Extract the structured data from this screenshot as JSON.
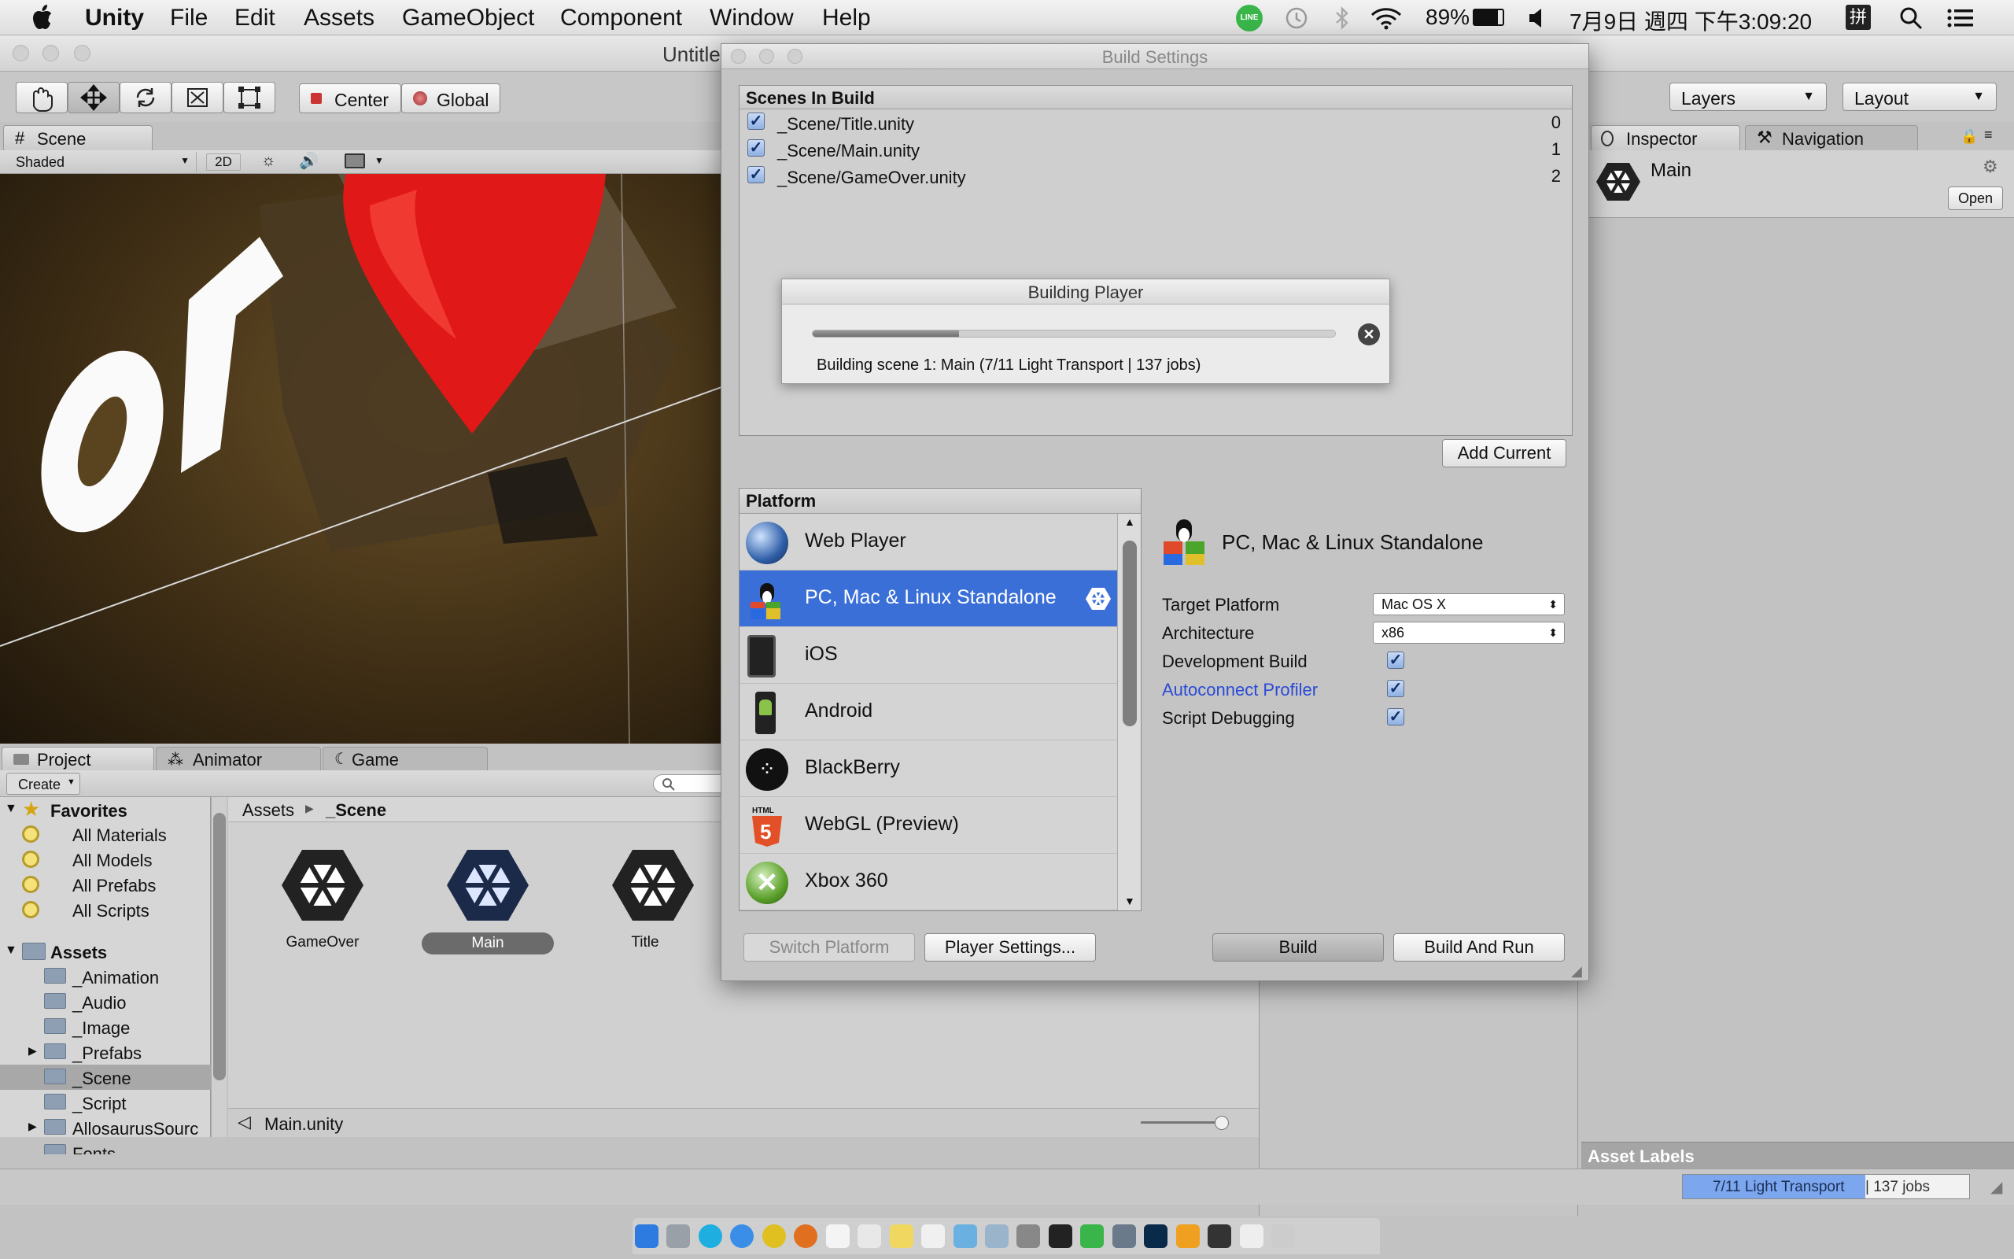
{
  "menubar": {
    "app_name": "Unity",
    "items": [
      "File",
      "Edit",
      "Assets",
      "GameObject",
      "Component",
      "Window",
      "Help"
    ],
    "status": {
      "line": "LINE",
      "battery": "89%",
      "datetime": "7月9日 週四 下午3:09:20",
      "input_method": "拼"
    }
  },
  "main_window": {
    "title": "Untitled",
    "toolbar": {
      "center_label": "Center",
      "global_label": "Global",
      "layers_label": "Layers",
      "layout_label": "Layout"
    }
  },
  "scene_panel": {
    "tab_label": "Scene",
    "shading_mode": "Shaded",
    "mode_2d": "2D"
  },
  "project_panel": {
    "tabs": [
      "Project",
      "Animator",
      "Game"
    ],
    "create_label": "Create",
    "favorites_label": "Favorites",
    "favorites": [
      "All Materials",
      "All Models",
      "All Prefabs",
      "All Scripts"
    ],
    "assets_label": "Assets",
    "folders": [
      "_Animation",
      "_Audio",
      "_Image",
      "_Prefabs",
      "_Scene",
      "_Script",
      "AllosaurusSourc",
      "Fonts"
    ],
    "breadcrumb": [
      "Assets",
      "_Scene"
    ],
    "files": [
      {
        "name": "GameOver",
        "selected": false
      },
      {
        "name": "Main",
        "selected": true
      },
      {
        "name": "Title",
        "selected": false
      }
    ],
    "status_file": "Main.unity"
  },
  "inspector": {
    "tab_label": "Inspector",
    "nav_tab_label": "Navigation",
    "object_name": "Main",
    "open_label": "Open",
    "asset_labels": "Asset Labels"
  },
  "statusbar": {
    "progress_label": "7/11 Light Transport | 137 jobs",
    "progress_split": [
      "7/11 Light Transport",
      " | 137 jobs"
    ]
  },
  "build_settings": {
    "title": "Build Settings",
    "scenes_header": "Scenes In Build",
    "scenes": [
      {
        "path": "_Scene/Title.unity",
        "index": "0",
        "checked": true
      },
      {
        "path": "_Scene/Main.unity",
        "index": "1",
        "checked": true
      },
      {
        "path": "_Scene/GameOver.unity",
        "index": "2",
        "checked": true
      }
    ],
    "add_current_label": "Add Current",
    "building_popup": {
      "title": "Building Player",
      "progress": 0.28,
      "message": "Building scene 1: Main (7/11 Light Transport | 137 jobs)"
    },
    "platform_header": "Platform",
    "platforms": [
      {
        "name": "Web Player",
        "selected": false,
        "icon": "globe-icon"
      },
      {
        "name": "PC, Mac & Linux Standalone",
        "selected": true,
        "icon": "standalone-icon"
      },
      {
        "name": "iOS",
        "selected": false,
        "icon": "ios-device-icon"
      },
      {
        "name": "Android",
        "selected": false,
        "icon": "android-icon"
      },
      {
        "name": "BlackBerry",
        "selected": false,
        "icon": "blackberry-icon"
      },
      {
        "name": "WebGL (Preview)",
        "selected": false,
        "icon": "html5-icon"
      },
      {
        "name": "Xbox 360",
        "selected": false,
        "icon": "xbox-icon"
      }
    ],
    "selected_platform_title": "PC, Mac & Linux Standalone",
    "settings": {
      "target_platform_label": "Target Platform",
      "target_platform_value": "Mac OS X",
      "architecture_label": "Architecture",
      "architecture_value": "x86",
      "development_build_label": "Development Build",
      "autoconnect_profiler_label": "Autoconnect Profiler",
      "script_debugging_label": "Script Debugging"
    },
    "buttons": {
      "switch_platform": "Switch Platform",
      "player_settings": "Player Settings...",
      "build": "Build",
      "build_and_run": "Build And Run"
    },
    "colors": {
      "selection": "#3b6fd8",
      "link": "#2a4bd6"
    }
  }
}
